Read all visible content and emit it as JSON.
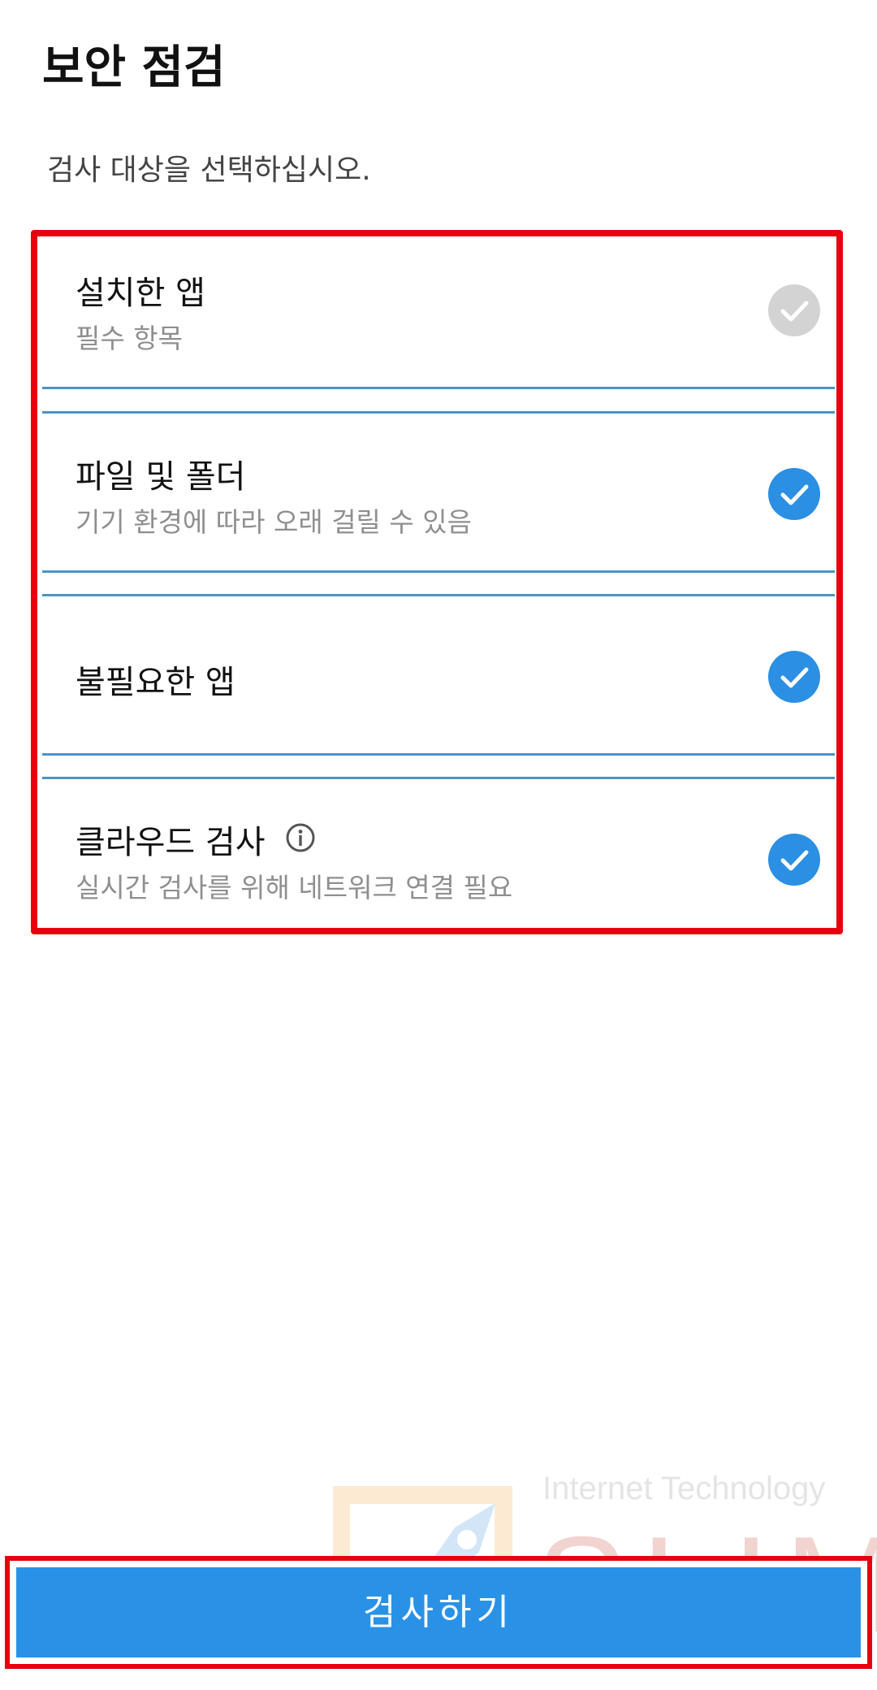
{
  "header": {
    "title": "보안 점검",
    "subtitle": "검사 대상을 선택하십시오."
  },
  "options": [
    {
      "title": "설치한 앱",
      "description": "필수 항목",
      "checked": true,
      "disabled": true
    },
    {
      "title": "파일 및 폴더",
      "description": "기기 환경에 따라 오래 걸릴 수 있음",
      "checked": true,
      "disabled": false
    },
    {
      "title": "불필요한 앱",
      "description": "",
      "checked": true,
      "disabled": false
    },
    {
      "title": "클라우드 검사",
      "description": "실시간 검사를 위해 네트워크 연결 필요",
      "checked": true,
      "disabled": false,
      "icon": "info-icon"
    }
  ],
  "footer": {
    "scan_label": "검사하기"
  },
  "watermark": {
    "tagline": "Internet Technology",
    "brand": "SLIM"
  },
  "colors": {
    "accent": "#2b8fe3",
    "check_disabled": "#d3d3d3",
    "divider": "#4a94c7",
    "highlight": "#e8000f"
  }
}
